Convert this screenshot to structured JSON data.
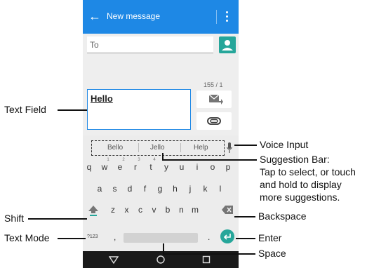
{
  "app_bar": {
    "back_icon": "arrow-left-icon",
    "title": "New message",
    "menu_icon": "overflow-menu-icon",
    "color": "#1e88e5"
  },
  "recipient": {
    "placeholder": "To",
    "contact_icon": "person-icon"
  },
  "message": {
    "counter": "155 / 1",
    "text": "Hello",
    "send_icon": "send-mms-icon",
    "attach_icon": "paperclip-icon"
  },
  "keyboard": {
    "suggestions": [
      "Bello",
      "Jello",
      "Help"
    ],
    "mic_icon": "microphone-icon",
    "row1": [
      "q",
      "w",
      "e",
      "r",
      "t",
      "y",
      "u",
      "i",
      "o",
      "p"
    ],
    "row1_hints": [
      "",
      "1",
      "2",
      "3",
      "4",
      "",
      "",
      "",
      "",
      ""
    ],
    "row2": [
      "a",
      "s",
      "d",
      "f",
      "g",
      "h",
      "j",
      "k",
      "l"
    ],
    "row3": [
      "z",
      "x",
      "c",
      "v",
      "b",
      "n",
      "m"
    ],
    "shift_icon": "shift-arrow-icon",
    "backspace_icon": "backspace-icon",
    "mode_label": "?123",
    "comma": ",",
    "period": ".",
    "enter_icon": "enter-arrow-icon",
    "accent": "#26a69a"
  },
  "navbar": {
    "back_icon": "triangle-back-icon",
    "home_icon": "circle-home-icon",
    "recent_icon": "square-recent-icon"
  },
  "callouts": {
    "text_field": "Text Field",
    "voice_input": "Voice Input",
    "suggestion_bar": [
      "Suggestion Bar:",
      "Tap to select, or touch",
      "and hold to display",
      "more suggestions."
    ],
    "shift": "Shift",
    "backspace": "Backspace",
    "text_mode": "Text Mode",
    "enter": "Enter",
    "space": "Space"
  }
}
